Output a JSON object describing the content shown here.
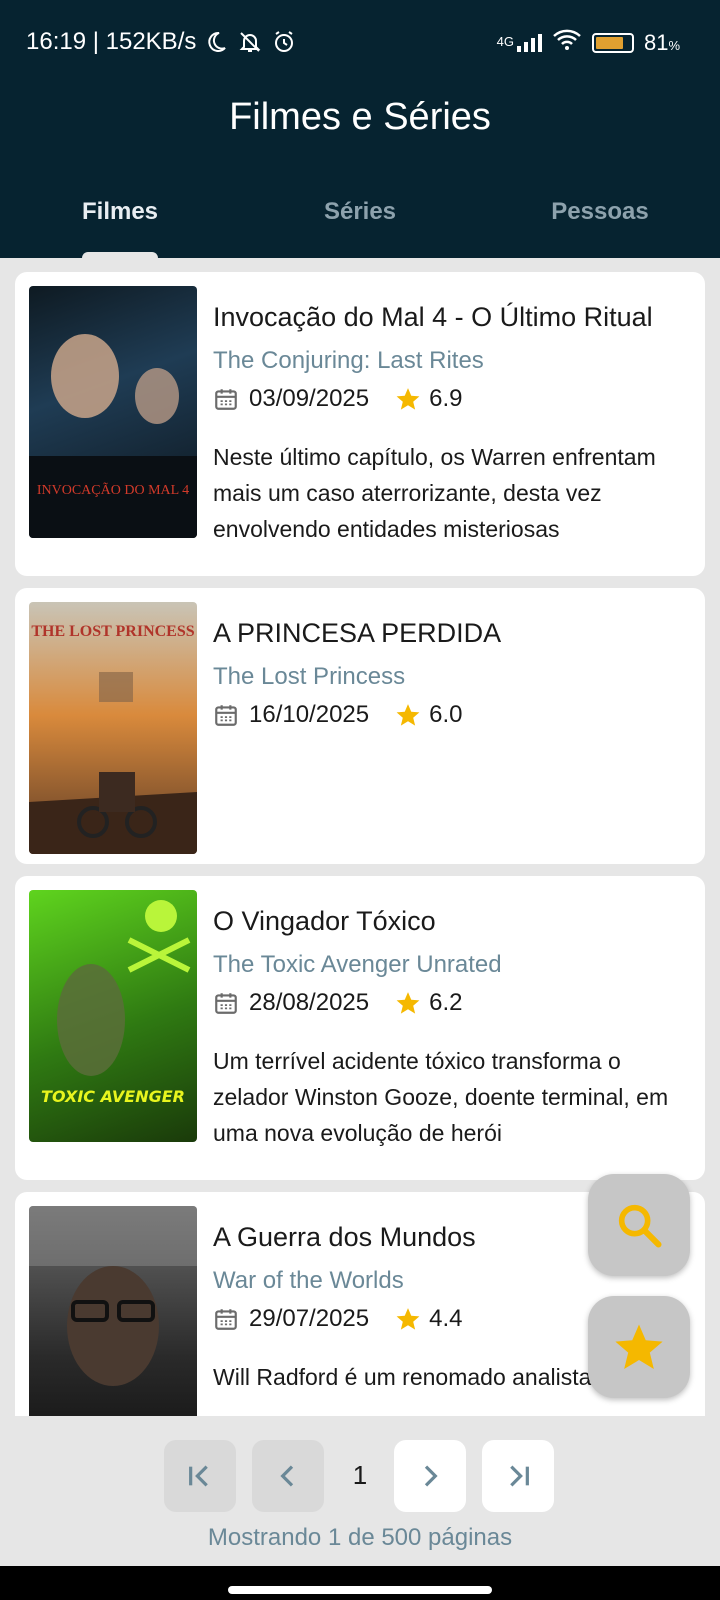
{
  "status_bar": {
    "time": "16:19 | 152KB/s",
    "network": "4G",
    "battery": "81"
  },
  "app_title": "Filmes e Séries",
  "tabs": [
    {
      "label": "Filmes",
      "active": true
    },
    {
      "label": "Séries",
      "active": false
    },
    {
      "label": "Pessoas",
      "active": false
    }
  ],
  "movies": [
    {
      "title": "Invocação do Mal 4 - O Último Ritual",
      "original_title": "The Conjuring: Last Rites",
      "date": "03/09/2025",
      "rating": "6.9",
      "overview": "Neste último capítulo, os Warren enfrentam mais um caso aterrorizante, desta vez envolvendo entidades misteriosas",
      "poster_text": "INVOCAÇÃO DO MAL 4"
    },
    {
      "title": "A PRINCESA PERDIDA",
      "original_title": "The Lost Princess",
      "date": "16/10/2025",
      "rating": "6.0",
      "overview": "",
      "poster_text": "THE LOST PRINCESS"
    },
    {
      "title": "O Vingador Tóxico",
      "original_title": "The Toxic Avenger Unrated",
      "date": "28/08/2025",
      "rating": "6.2",
      "overview": "Um terrível acidente tóxico transforma o zelador Winston Gooze, doente terminal, em uma nova evolução de herói",
      "poster_text": "TOXIC AVENGER"
    },
    {
      "title": "A Guerra dos Mundos",
      "original_title": "War of the Worlds",
      "date": "29/07/2025",
      "rating": "4.4",
      "overview": "Will Radford é um renomado analista",
      "poster_text": ""
    }
  ],
  "pagination": {
    "current_page": "1",
    "info": "Mostrando 1 de 500 páginas"
  },
  "colors": {
    "header_bg": "#062330",
    "accent_star": "#f5b800",
    "muted_text": "#6a8897",
    "background": "#e6e6e6"
  },
  "icons": {
    "calendar": "calendar-icon",
    "star": "star-icon",
    "search_fab": "search-icon",
    "favorites_fab": "star-icon"
  }
}
